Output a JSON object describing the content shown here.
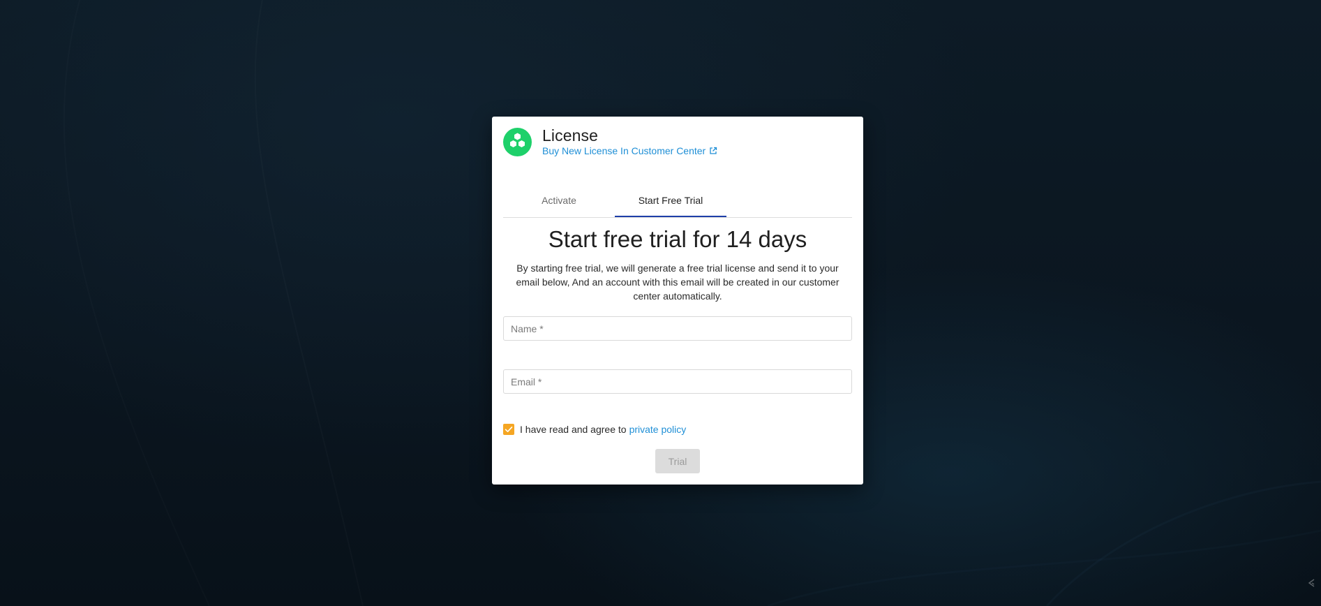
{
  "dialog": {
    "title": "License",
    "buy_link_label": "Buy New License In Customer Center",
    "tabs": [
      {
        "label": "Activate",
        "active": false
      },
      {
        "label": "Start Free Trial",
        "active": true
      }
    ],
    "heading": "Start free trial for 14 days",
    "description": "By starting free trial, we will generate a free trial license and send it to your email below, And an account with this email will be created in our customer center automatically.",
    "name_field": {
      "placeholder": "Name *",
      "value": ""
    },
    "email_field": {
      "placeholder": "Email *",
      "value": ""
    },
    "agree": {
      "checked": true,
      "label": "I have read and agree to",
      "link_label": "private policy"
    },
    "trial_button_label": "Trial"
  },
  "icons": {
    "logo": "hexagon-cluster-logo",
    "external_link": "external-link-icon",
    "check": "check-icon",
    "corner": "collapse-arrow-icon"
  },
  "colors": {
    "brand_green": "#1ed06a",
    "link_blue": "#1f8fd6",
    "tab_underline": "#1e3ea8",
    "checkbox_orange": "#f5a623",
    "disabled_button": "#dcdcdc"
  }
}
